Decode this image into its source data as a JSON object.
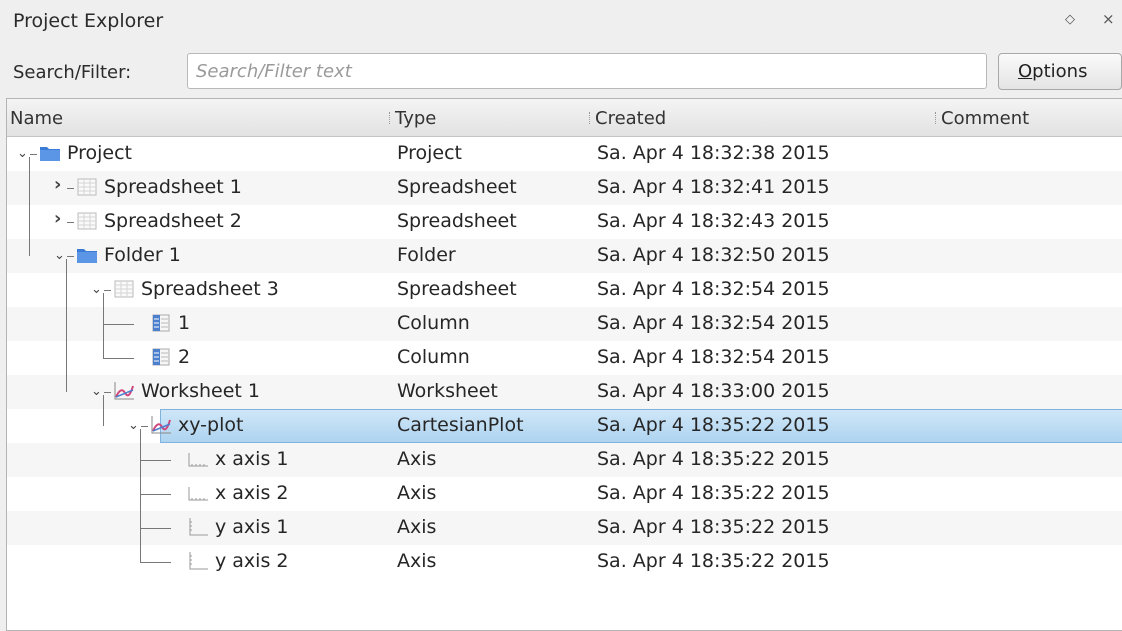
{
  "window": {
    "title": "Project Explorer",
    "float_glyph": "◇",
    "close_glyph": "×"
  },
  "search": {
    "label": "Search/Filter:",
    "placeholder": "Search/Filter text",
    "value": "",
    "options_label": "Options"
  },
  "columns": {
    "name": "Name",
    "type": "Type",
    "created": "Created",
    "comment": "Comment"
  },
  "expander_glyphs": {
    "expanded": "⌄",
    "collapsed": "›"
  },
  "rows": [
    {
      "name": "Project",
      "type": "Project",
      "created": "Sa. Apr 4 18:32:38 2015",
      "icon": "folder-icon",
      "level": 0,
      "expander": "expanded"
    },
    {
      "name": "Spreadsheet 1",
      "type": "Spreadsheet",
      "created": "Sa. Apr 4 18:32:41 2015",
      "icon": "spreadsheet-icon",
      "level": 1,
      "expander": "collapsed"
    },
    {
      "name": "Spreadsheet 2",
      "type": "Spreadsheet",
      "created": "Sa. Apr 4 18:32:43 2015",
      "icon": "spreadsheet-icon",
      "level": 1,
      "expander": "collapsed"
    },
    {
      "name": "Folder 1",
      "type": "Folder",
      "created": "Sa. Apr 4 18:32:50 2015",
      "icon": "folder-icon",
      "level": 1,
      "expander": "expanded"
    },
    {
      "name": "Spreadsheet 3",
      "type": "Spreadsheet",
      "created": "Sa. Apr 4 18:32:54 2015",
      "icon": "spreadsheet-icon",
      "level": 2,
      "expander": "expanded"
    },
    {
      "name": "1",
      "type": "Column",
      "created": "Sa. Apr 4 18:32:54 2015",
      "icon": "column-icon",
      "level": 3,
      "expander": "none"
    },
    {
      "name": "2",
      "type": "Column",
      "created": "Sa. Apr 4 18:32:54 2015",
      "icon": "column-icon",
      "level": 3,
      "expander": "none"
    },
    {
      "name": "Worksheet 1",
      "type": "Worksheet",
      "created": "Sa. Apr 4 18:33:00 2015",
      "icon": "worksheet-icon",
      "level": 2,
      "expander": "expanded"
    },
    {
      "name": "xy-plot",
      "type": "CartesianPlot",
      "created": "Sa. Apr 4 18:35:22 2015",
      "icon": "plot-icon",
      "level": 3,
      "expander": "expanded",
      "selected": true
    },
    {
      "name": "x axis 1",
      "type": "Axis",
      "created": "Sa. Apr 4 18:35:22 2015",
      "icon": "x-axis-icon",
      "level": 4,
      "expander": "none"
    },
    {
      "name": "x axis 2",
      "type": "Axis",
      "created": "Sa. Apr 4 18:35:22 2015",
      "icon": "x-axis-icon",
      "level": 4,
      "expander": "none"
    },
    {
      "name": "y axis 1",
      "type": "Axis",
      "created": "Sa. Apr 4 18:35:22 2015",
      "icon": "y-axis-icon",
      "level": 4,
      "expander": "none"
    },
    {
      "name": "y axis 2",
      "type": "Axis",
      "created": "Sa. Apr 4 18:35:22 2015",
      "icon": "y-axis-icon",
      "level": 4,
      "expander": "none"
    }
  ],
  "colors": {
    "selection": "#aed4f0",
    "folder": "#3a7bd5",
    "plot_line": "#d1457a"
  }
}
